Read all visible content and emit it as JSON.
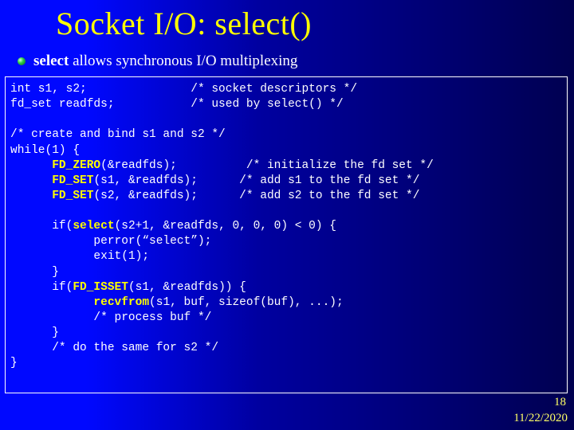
{
  "title": "Socket I/O: select()",
  "bullet": {
    "bold_lead": "select",
    "rest": " allows synchronous I/O multiplexing"
  },
  "code": {
    "l01a": "int s1, s2;",
    "l01b": "/* socket descriptors */",
    "l02a": "fd_set readfds;",
    "l02b": "/* used by select() */",
    "l03": "",
    "l04": "/* create and bind s1 and s2 */",
    "l05": "while(1) {",
    "l06a": "      ",
    "l06hl": "FD_ZERO",
    "l06b": "(&readfds);          /* initialize the fd set */",
    "l07a": "      ",
    "l07hl": "FD_SET",
    "l07b": "(s1, &readfds);      /* add s1 to the fd set */",
    "l08a": "      ",
    "l08hl": "FD_SET",
    "l08b": "(s2, &readfds);      /* add s2 to the fd set */",
    "l09": "",
    "l10a": "      if(",
    "l10hl": "select",
    "l10b": "(s2+1, &readfds, 0, 0, 0) < 0) {",
    "l11": "            perror(“select”);",
    "l12": "            exit(1);",
    "l13": "      }",
    "l14a": "      if(",
    "l14hl": "FD_ISSET",
    "l14b": "(s1, &readfds)) {",
    "l15a": "            ",
    "l15hl": "recvfrom",
    "l15b": "(s1, buf, sizeof(buf), ...);",
    "l16": "            /* process buf */",
    "l17": "      }",
    "l18": "      /* do the same for s2 */",
    "l19": "}"
  },
  "page_number": "18",
  "date": "11/22/2020"
}
